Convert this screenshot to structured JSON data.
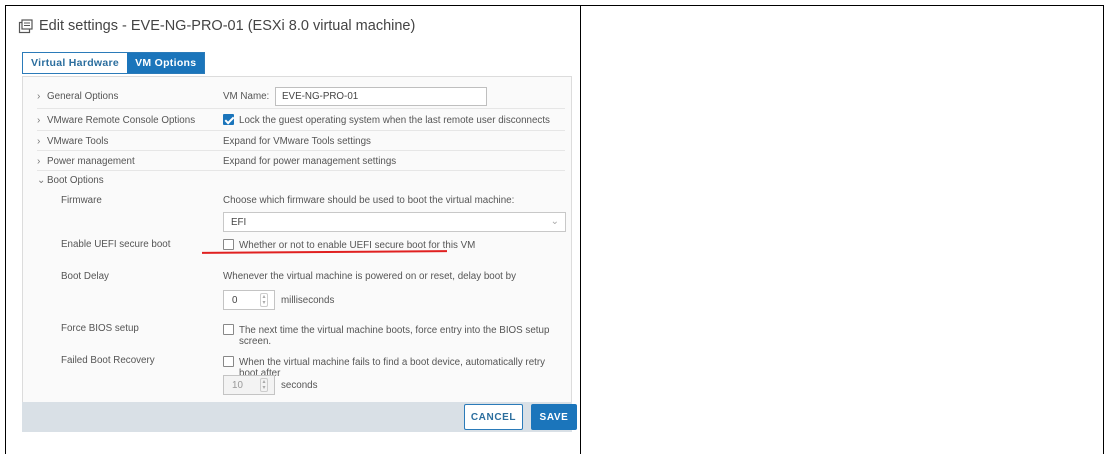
{
  "window": {
    "title": "Edit settings - EVE-NG-PRO-01 (ESXi 8.0 virtual machine)"
  },
  "tabs": [
    {
      "label": "Virtual Hardware",
      "active": false
    },
    {
      "label": "VM Options",
      "active": true
    }
  ],
  "sections": {
    "general": {
      "label": "General Options",
      "vm_name_label": "VM Name:",
      "vm_name_value": "EVE-NG-PRO-01"
    },
    "remote_console": {
      "label": "VMware Remote Console Options",
      "lock_text": "Lock the guest operating system when the last remote user disconnects",
      "lock_checked": true
    },
    "tools": {
      "label": "VMware Tools",
      "text": "Expand for VMware Tools settings"
    },
    "power": {
      "label": "Power management",
      "text": "Expand for power management settings"
    },
    "boot": {
      "label": "Boot Options",
      "firmware_label": "Firmware",
      "firmware_desc": "Choose which firmware should be used to boot the virtual machine:",
      "firmware_value": "EFI",
      "secure_boot_label": "Enable UEFI secure boot",
      "secure_boot_text": "Whether or not to enable UEFI secure boot for this VM",
      "secure_boot_checked": false,
      "delay_label": "Boot Delay",
      "delay_desc": "Whenever the virtual machine is powered on or reset, delay boot by",
      "delay_value": "0",
      "delay_unit": "milliseconds",
      "bios_label": "Force BIOS setup",
      "bios_text": "The next time the virtual machine boots, force entry into the BIOS setup screen.",
      "bios_checked": false,
      "recovery_label": "Failed Boot Recovery",
      "recovery_text": "When the virtual machine fails to find a boot device, automatically retry boot after",
      "recovery_checked": false,
      "recovery_value": "10",
      "recovery_unit": "seconds"
    }
  },
  "footer": {
    "cancel_label": "CANCEL",
    "save_label": "SAVE"
  },
  "colors": {
    "accent": "#1b75bb",
    "annotation": "#e02020"
  },
  "icons": {
    "title": "vm-settings-icon",
    "collapsed": "chevron-right-icon",
    "expanded": "chevron-down-icon",
    "select": "chevron-down-icon"
  }
}
